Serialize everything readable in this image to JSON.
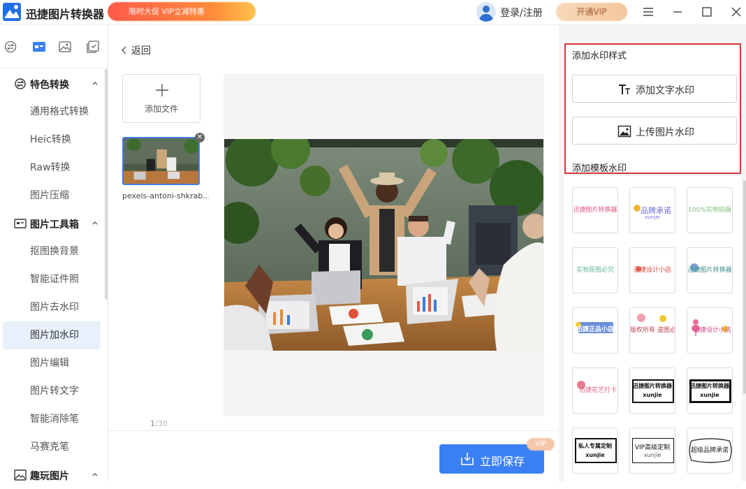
{
  "app": {
    "title": "迅捷图片转换器",
    "promo_text": "限时大促 VIP立减特惠",
    "login_label": "登录/注册",
    "vip_label": "开通VIP"
  },
  "sidebar": {
    "groups": [
      {
        "label": "特色转换",
        "items": [
          "通用格式转换",
          "Heic转换",
          "Raw转换",
          "图片压缩"
        ]
      },
      {
        "label": "图片工具箱",
        "items": [
          "抠图换背景",
          "智能证件照",
          "图片去水印",
          "图片加水印",
          "图片编辑",
          "图片转文字",
          "智能消除笔",
          "马赛克笔"
        ]
      },
      {
        "label": "趣玩图片",
        "items": []
      }
    ],
    "active_item": "图片加水印"
  },
  "main": {
    "back_label": "返回",
    "add_file_label": "添加文件",
    "file_name": "pexels-antoni-shkrab...",
    "page_current": "1",
    "page_total": "/30",
    "save_label": "立即保存",
    "save_badge": "VIP"
  },
  "watermark_panel": {
    "style_title": "添加水印样式",
    "add_text_label": "添加文字水印",
    "upload_image_label": "上传图片水印",
    "template_title": "添加模板水印",
    "templates": [
      {
        "text": "迅捷图片转换器",
        "sub": "",
        "color": "#e4577b"
      },
      {
        "text": "品牌承诺",
        "sub": "xunjie",
        "color": "#6b6bd6"
      },
      {
        "text": "100%实物拍摄",
        "sub": "",
        "color": "#7fc07a"
      },
      {
        "text": "实物原图必究",
        "sub": "",
        "color": "#67b89a"
      },
      {
        "text": "迅捷设计小店",
        "sub": "",
        "color": "#d8473a"
      },
      {
        "text": "迅捷图片转换器",
        "sub": "",
        "color": "#3f8f8a"
      },
      {
        "text": "迅捷正品小店",
        "sub": "",
        "color": "#ffffff"
      },
      {
        "text": "版权所有 盗图必究",
        "sub": "",
        "color": "#c04a5a"
      },
      {
        "text": "迅捷设计小店",
        "sub": "",
        "color": "#c64a85"
      },
      {
        "text": "迅捷花艺打卡",
        "sub": "",
        "color": "#e06a7a"
      },
      {
        "text": "迅捷图片转换器",
        "sub": "xunjie",
        "color": "#111111"
      },
      {
        "text": "迅捷图片转换器",
        "sub": "xunjie",
        "color": "#111111"
      },
      {
        "text": "私人专属定制",
        "sub": "xunjie",
        "color": "#111111"
      },
      {
        "text": "VIP高级定制",
        "sub": "xunjie",
        "color": "#111111"
      },
      {
        "text": "超级品牌承诺",
        "sub": "",
        "color": "#111111"
      }
    ]
  },
  "colors": {
    "accent": "#3b80f2",
    "highlight_border": "#d9363e",
    "active_nav_bg": "#e8f0fc"
  }
}
